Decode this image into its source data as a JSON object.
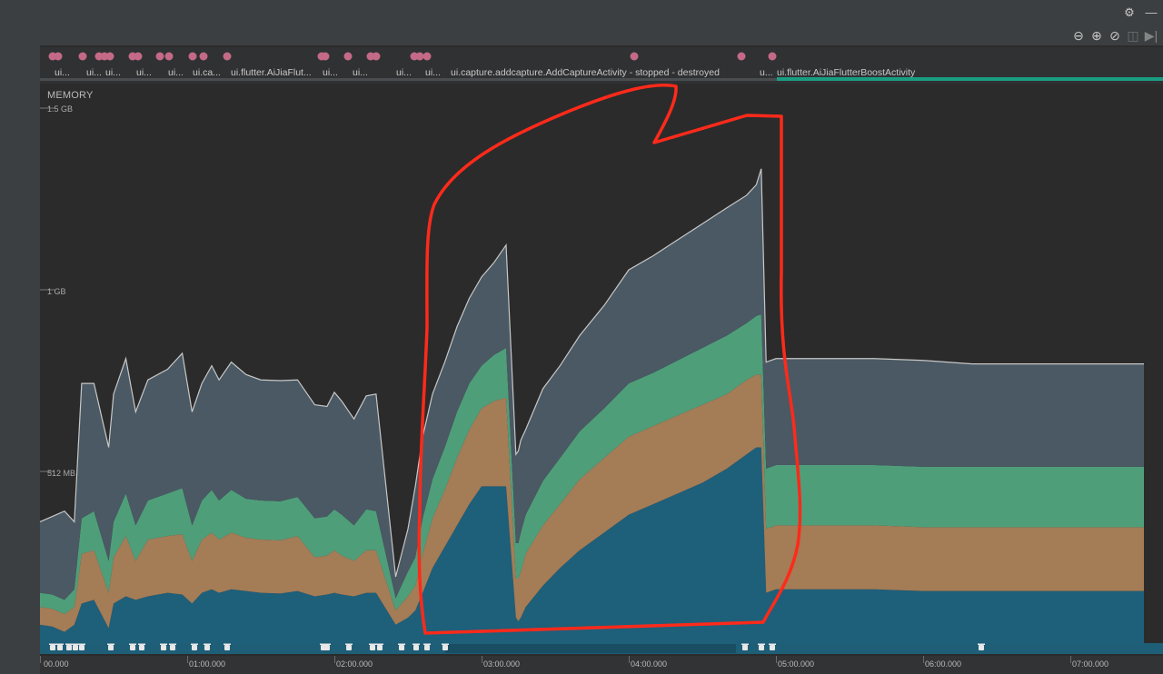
{
  "toolbar": {
    "settings_icon": "gear-icon",
    "minimize_icon": "minimize-icon",
    "zoom_out_icon": "zoom-out-icon",
    "zoom_in_icon": "zoom-in-icon",
    "reset_zoom_icon": "reset-zoom-icon",
    "pause_icon": "pause-icon",
    "go_live_icon": "go-live-icon"
  },
  "activity_labels": [
    "ui...",
    "ui...",
    "ui...",
    "ui...",
    "ui...",
    "ui.ca...",
    "ui.flutter.AiJiaFlut...",
    "ui...",
    "ui...",
    "ui...",
    "ui...",
    "ui.capture.addcapture.AddCaptureActivity - stopped - destroyed",
    "u...",
    "ui.flutter.AiJiaFlutterBoostActivity"
  ],
  "colors": {
    "java": "#1e5f7a",
    "native": "#a47c56",
    "graphics": "#4f9e7a",
    "other": "#4a5963",
    "total_line": "#c8c8c8",
    "event_dot": "#c46a86",
    "active_bar": "#1a9e83",
    "annotation": "#ff2a1a"
  },
  "chart_data": {
    "type": "area",
    "title": "MEMORY",
    "stacked": true,
    "x_unit": "time (mm:ss)",
    "y_unit": "MB",
    "xlim": [
      "00:00.000",
      "07:30.000"
    ],
    "ylim": [
      0,
      1536
    ],
    "y_tick_labels": [
      "1.5 GB",
      "1 GB",
      "512 MB"
    ],
    "y_tick_values": [
      1536,
      1024,
      512
    ],
    "x_tick_labels": [
      "00.000",
      "01:00.000",
      "02:00.000",
      "03:00.000",
      "04:00.000",
      "05:00.000",
      "06:00.000",
      "07:00.000"
    ],
    "x_tick_seconds": [
      0,
      60,
      120,
      180,
      240,
      300,
      360,
      420
    ],
    "t": [
      0,
      5,
      10,
      14,
      17,
      22,
      28,
      30,
      35,
      39,
      44,
      52,
      58,
      62,
      66,
      70,
      73,
      78,
      84,
      90,
      98,
      105,
      112,
      117,
      120,
      123,
      128,
      133,
      137,
      145,
      150,
      153,
      156,
      160,
      165,
      170,
      175,
      180,
      185,
      190,
      194,
      195,
      196,
      198,
      205,
      212,
      220,
      230,
      240,
      250,
      260,
      270,
      280,
      288,
      292,
      294,
      296,
      300,
      320,
      340,
      360,
      380,
      400,
      420,
      450
    ],
    "series": [
      {
        "key": "java",
        "values": [
          80,
          75,
          60,
          80,
          140,
          150,
          70,
          140,
          160,
          150,
          160,
          170,
          165,
          140,
          170,
          180,
          170,
          180,
          175,
          170,
          168,
          175,
          160,
          165,
          170,
          165,
          160,
          170,
          170,
          80,
          100,
          120,
          170,
          240,
          300,
          360,
          420,
          470,
          470,
          470,
          100,
          90,
          100,
          130,
          190,
          240,
          290,
          340,
          390,
          420,
          450,
          480,
          520,
          560,
          580,
          580,
          170,
          180,
          180,
          180,
          175,
          175,
          175,
          175,
          175
        ]
      },
      {
        "key": "native",
        "values": [
          50,
          50,
          50,
          50,
          140,
          140,
          100,
          130,
          170,
          110,
          160,
          160,
          170,
          120,
          150,
          160,
          150,
          160,
          150,
          150,
          150,
          155,
          110,
          110,
          120,
          110,
          100,
          120,
          120,
          40,
          60,
          70,
          110,
          140,
          160,
          190,
          210,
          220,
          240,
          250,
          110,
          120,
          130,
          150,
          170,
          180,
          200,
          210,
          220,
          220,
          220,
          220,
          210,
          210,
          205,
          205,
          180,
          180,
          180,
          180,
          180,
          180,
          180,
          180,
          180
        ]
      },
      {
        "key": "graphics",
        "values": [
          40,
          40,
          40,
          50,
          100,
          110,
          90,
          100,
          120,
          100,
          110,
          120,
          130,
          100,
          110,
          120,
          110,
          120,
          110,
          110,
          110,
          110,
          110,
          110,
          115,
          115,
          100,
          115,
          110,
          35,
          70,
          80,
          100,
          110,
          120,
          130,
          130,
          120,
          130,
          140,
          100,
          100,
          110,
          110,
          125,
          130,
          135,
          140,
          150,
          150,
          155,
          160,
          165,
          160,
          165,
          170,
          170,
          170,
          170,
          170,
          170,
          170,
          170,
          170,
          170
        ]
      },
      {
        "key": "other",
        "values": [
          200,
          220,
          250,
          190,
          380,
          360,
          320,
          360,
          380,
          320,
          340,
          350,
          380,
          320,
          330,
          350,
          340,
          360,
          350,
          340,
          340,
          330,
          320,
          310,
          330,
          320,
          300,
          320,
          330,
          60,
          120,
          200,
          230,
          240,
          240,
          240,
          240,
          250,
          260,
          290,
          250,
          260,
          260,
          240,
          260,
          260,
          270,
          290,
          320,
          330,
          340,
          350,
          360,
          360,
          370,
          410,
          300,
          300,
          300,
          300,
          300,
          290,
          290,
          290,
          290
        ]
      }
    ]
  }
}
